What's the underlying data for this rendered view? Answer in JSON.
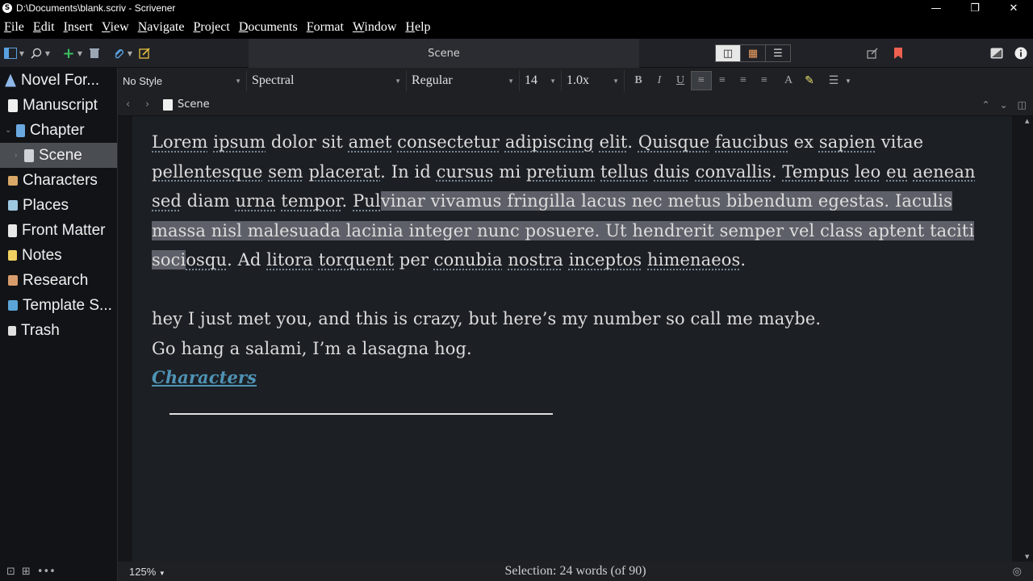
{
  "window": {
    "title": "D:\\Documents\\blank.scriv - Scrivener",
    "controls": [
      "—",
      "❐",
      "✕"
    ]
  },
  "menu": [
    "File",
    "Edit",
    "Insert",
    "View",
    "Navigate",
    "Project",
    "Documents",
    "Format",
    "Window",
    "Help"
  ],
  "toolbar": {
    "center_title": "Scene",
    "view_modes": [
      "◫",
      "▦",
      "☰"
    ]
  },
  "binder": {
    "items": [
      {
        "label": "Novel For...",
        "icon_color": "#8fb7e8",
        "indent": 6,
        "disclosure": ""
      },
      {
        "label": "Manuscript",
        "icon_color": "#f0f0f0",
        "indent": 10,
        "disclosure": ""
      },
      {
        "label": "Chapter",
        "icon_color": "#6aa8e0",
        "indent": 20,
        "disclosure": "⌄"
      },
      {
        "label": "Scene",
        "icon_color": "#cfd3d8",
        "indent": 30,
        "disclosure": "›"
      },
      {
        "label": "Characters",
        "icon_color": "#d9a868",
        "indent": 10,
        "disclosure": ""
      },
      {
        "label": "Places",
        "icon_color": "#9ec7e0",
        "indent": 10,
        "disclosure": ""
      },
      {
        "label": "Front Matter",
        "icon_color": "#e8e8e8",
        "indent": 10,
        "disclosure": ""
      },
      {
        "label": "Notes",
        "icon_color": "#f0d060",
        "indent": 10,
        "disclosure": ""
      },
      {
        "label": "Research",
        "icon_color": "#d89c6c",
        "indent": 10,
        "disclosure": ""
      },
      {
        "label": "Template S...",
        "icon_color": "#5aa4d8",
        "indent": 10,
        "disclosure": ""
      },
      {
        "label": "Trash",
        "icon_color": "#e0e0e0",
        "indent": 10,
        "disclosure": ""
      }
    ]
  },
  "formatbar": {
    "style": "No Style",
    "font": "Spectral",
    "weight": "Regular",
    "size": "14",
    "spacing": "1.0x"
  },
  "header": {
    "doc_title": "Scene"
  },
  "editor": {
    "para1": {
      "before": [
        {
          "t": "Lorem",
          "s": true
        },
        {
          "t": " "
        },
        {
          "t": "ipsum",
          "s": true
        },
        {
          "t": " dolor sit "
        },
        {
          "t": "amet",
          "s": true
        },
        {
          "t": " "
        },
        {
          "t": "consectetur",
          "s": true
        },
        {
          "t": " "
        },
        {
          "t": "adipiscing",
          "s": true
        },
        {
          "t": " "
        },
        {
          "t": "elit",
          "s": true
        },
        {
          "t": ". "
        },
        {
          "t": "Quisque",
          "s": true
        },
        {
          "t": " "
        },
        {
          "t": "faucibus",
          "s": true
        },
        {
          "t": " ex "
        },
        {
          "t": "sapien",
          "s": true
        },
        {
          "t": " vitae "
        },
        {
          "t": "pellentesque",
          "s": true
        },
        {
          "t": " "
        },
        {
          "t": "sem",
          "s": true
        },
        {
          "t": " "
        },
        {
          "t": "placerat",
          "s": true
        },
        {
          "t": ". In id "
        },
        {
          "t": "cursus",
          "s": true
        },
        {
          "t": " mi "
        },
        {
          "t": "pretium",
          "s": true
        },
        {
          "t": " "
        },
        {
          "t": "tellus",
          "s": true
        },
        {
          "t": " "
        },
        {
          "t": "duis",
          "s": true
        },
        {
          "t": " "
        },
        {
          "t": "convallis",
          "s": true
        },
        {
          "t": ". "
        },
        {
          "t": "Tempus",
          "s": true
        },
        {
          "t": " "
        },
        {
          "t": "leo",
          "s": true
        },
        {
          "t": " "
        },
        {
          "t": "eu",
          "s": true
        },
        {
          "t": " "
        },
        {
          "t": "aenean",
          "s": true
        },
        {
          "t": " "
        },
        {
          "t": "sed",
          "s": true
        },
        {
          "t": " diam "
        },
        {
          "t": "urna",
          "s": true
        },
        {
          "t": " "
        },
        {
          "t": "tempor",
          "s": true
        },
        {
          "t": ". "
        },
        {
          "t": "Pul",
          "s": true
        }
      ],
      "selected": "vinar vivamus fringilla lacus nec metus bibendum egestas. Iaculis massa nisl malesuada lacinia integer nunc posuere. Ut hendrerit semper vel class aptent taciti soci",
      "after": [
        {
          "t": "osqu",
          "s": true
        },
        {
          "t": ". Ad "
        },
        {
          "t": "litora",
          "s": true
        },
        {
          "t": " "
        },
        {
          "t": "torquent",
          "s": true
        },
        {
          "t": " per "
        },
        {
          "t": "conubia",
          "s": true
        },
        {
          "t": " "
        },
        {
          "t": "nostra",
          "s": true
        },
        {
          "t": " "
        },
        {
          "t": "inceptos",
          "s": true
        },
        {
          "t": " "
        },
        {
          "t": "himenaeos",
          "s": true
        },
        {
          "t": "."
        }
      ]
    },
    "line2": "hey I just met you, and this is crazy, but here’s my number so call me maybe.",
    "line3": "Go hang a salami, I’m a lasagna hog.",
    "link": "Characters"
  },
  "footer": {
    "zoom": "125%",
    "status": "Selection: 24 words (of 90)",
    "left_icons": [
      "⊡",
      "⊞",
      "•••"
    ]
  }
}
